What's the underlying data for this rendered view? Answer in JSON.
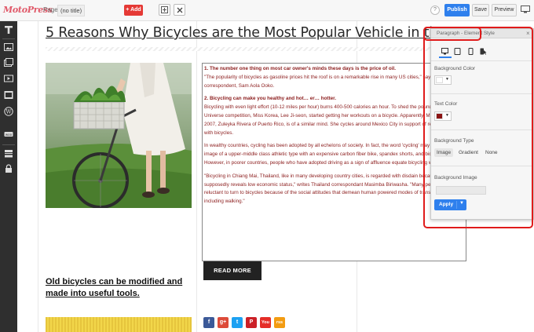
{
  "topbar": {
    "logo": "MotoPress",
    "page_label": "Page:",
    "page_value": "(no title)",
    "add_label": "+ Add",
    "help_label": "?",
    "publish_label": "Publish",
    "save_label": "Save",
    "preview_label": "Preview"
  },
  "content": {
    "title": "5 Reasons Why Bicycles are the Most Popular Vehicle in the W",
    "paragraph": {
      "p1_bold": "1. The number one thing on most car owner's minds these days is the price of oil.",
      "p1_text": "\"The popularity of bicycles as gasoline prices hit the roof is on a remarkable rise in many US cities,\" says Kenya correspondent, Sam Aola Ooko.",
      "p2_bold": "2. Bicycling can make you healthy and hot… er… hotter.",
      "p2_text": "Bicycling with even light effort (10-12 miles per hour) burns 400-500 calories an hour. To shed the pounds, the Miss Universe competition, Miss Korea, Lee Ji-seon, started getting her workouts on a bicycle. Apparently, Miss Universe 2007, Zuleyka Rivera of Puerto Rico, is of a similar mind. She cycles around Mexico City in support of replacing cars with bicycles.",
      "p3_text": "In wealthy countries, cycling has been adopted by all echelons of society. In fact, the word 'cycling' may conjure the image of a upper-middle class athletic type with an expensive carbon fiber bike, spandex shorts, and bicycle shoes. However, in poorer countries, people who have adopted driving as a sign of affluence equate bicycling with poverty.",
      "p4_text": "\"Bicycling in Chiang Mai, Thailand, like in many developing country cities, is regarded with disdain because it supposedly reveals low economic status,\" writes Thailand correspondant Masimba Biriwasha. \"Many people are reluctant to turn to bicycles because of the social attitudes that demean human powered modes of transportation, including walking.\""
    },
    "read_more": "READ MORE",
    "subheading": "Old bicycles can be modified and made into useful tools.",
    "social": [
      "f",
      "g+",
      "t",
      "P",
      "You",
      "rss"
    ]
  },
  "panel": {
    "title": "Paragraph - Element Style",
    "close": "×",
    "bg_color_label": "Background Color",
    "bg_color_value": "#ffffff",
    "text_color_label": "Text Color",
    "text_color_value": "#8b1414",
    "bg_type_label": "Background Type",
    "bg_type_options": [
      "Image",
      "Gradient",
      "None"
    ],
    "bg_type_selected": "Image",
    "bg_image_label": "Background Image",
    "apply_label": "Apply"
  },
  "colors": {
    "accent": "#2f80ed",
    "add": "#e53935",
    "highlight": "#e01b1b",
    "text_red": "#8b1c1c"
  }
}
